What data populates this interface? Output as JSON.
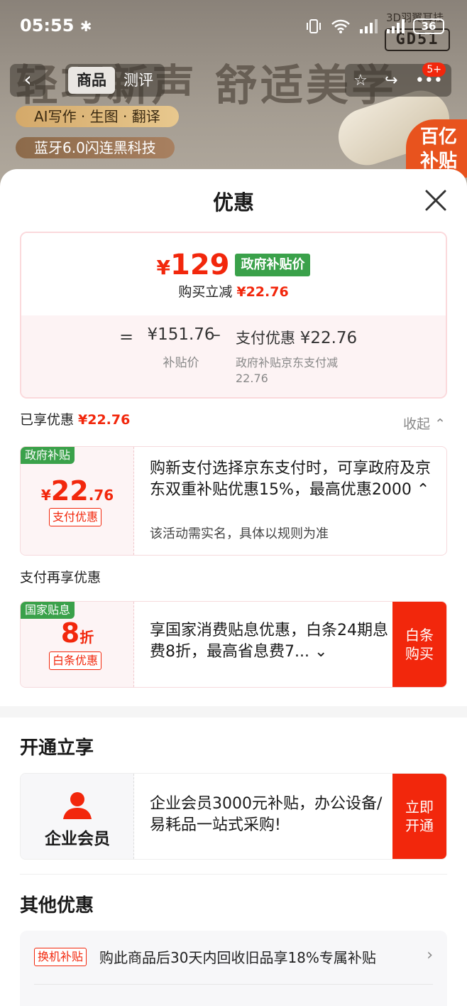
{
  "status_bar": {
    "time": "05:55",
    "battery": "36"
  },
  "background": {
    "watermark": "轻巧新声 舒适美学",
    "hint": "3D羽翼耳挂",
    "model": "GD51",
    "pills": [
      "AI写作 · 生图 · 翻译",
      "蓝牙6.0闪连黑科技"
    ],
    "badge": [
      "百亿",
      "补贴"
    ]
  },
  "nav": {
    "tabs": [
      "商品",
      "测评"
    ],
    "badge": "5+"
  },
  "sheet": {
    "title": "优惠"
  },
  "price": {
    "symbol": "¥",
    "value": "129",
    "tag": "政府补贴价",
    "reduce_label": "购买立减",
    "reduce_value": "¥22.76",
    "subsidy_value": "¥151.76",
    "subsidy_label": "补贴价",
    "pay_label": "支付优惠",
    "pay_value": "¥22.76",
    "pay_desc": "政府补贴京东支付减22.76"
  },
  "enjoyed": {
    "label": "已享优惠",
    "value": "¥22.76",
    "collapse": "收起"
  },
  "coupon_gov": {
    "tag": "政府补贴",
    "symbol": "¥",
    "amount": "22",
    "decimal": ".76",
    "chip": "支付优惠",
    "text": "购新支付选择京东支付时，可享政府及京东双重补贴优惠15%，最高优惠2000",
    "note": "该活动需实名，具体以规则为准"
  },
  "pay_again": {
    "label": "支付再享优惠"
  },
  "coupon_interest": {
    "tag": "国家贴息",
    "amount": "8",
    "unit": "折",
    "chip": "白条优惠",
    "text": "享国家消费贴息优惠，白条24期息费8折，最高省息费7...",
    "button": "白条购买"
  },
  "open_section": {
    "title": "开通立享"
  },
  "vip": {
    "name": "企业会员",
    "text": "企业会员3000元补贴，办公设备/易耗品一站式采购!",
    "button": "立即开通"
  },
  "other": {
    "title": "其他优惠",
    "rows": [
      {
        "tag": "换机补贴",
        "text": "购此商品后30天内回收旧品享18%专属补贴"
      }
    ]
  }
}
